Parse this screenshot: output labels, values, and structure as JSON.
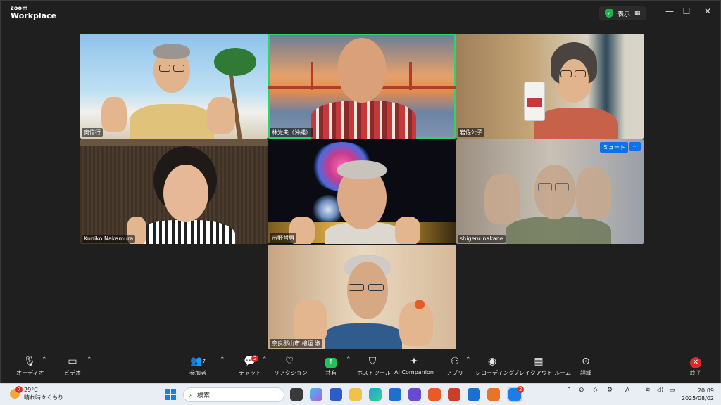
{
  "window": {
    "logo_line1": "zoom",
    "logo_line2": "Workplace",
    "view_label": "表示",
    "view_icon": "grid-icon",
    "controls": [
      "—",
      "☐",
      "✕"
    ]
  },
  "participants": [
    {
      "name": "奥信行",
      "bg": "#7fb7de"
    },
    {
      "name": "林光夫（沖縄）",
      "bg": "#d58a52",
      "active": true
    },
    {
      "name": "岩佐公子",
      "bg": "#b4956a"
    },
    {
      "name": "Kuniko Nakamura",
      "bg": "#4a3a2c"
    },
    {
      "name": "示野哲男",
      "bg": "#0b0b14"
    },
    {
      "name": "shigeru nakane",
      "bg": "#8c857a",
      "badges": [
        "ミュート",
        "···"
      ]
    },
    {
      "name": "奈良郡山市 檜垣 淑",
      "bg": "#caa989"
    }
  ],
  "toolbar": {
    "audio": {
      "label": "オーディオ",
      "icon": "microphone-icon"
    },
    "video": {
      "label": "ビデオ",
      "icon": "video-camera-icon"
    },
    "participants": {
      "label": "参加者",
      "count": "7",
      "icon": "participants-icon"
    },
    "chat": {
      "label": "チャット",
      "badge": "2",
      "icon": "chat-icon"
    },
    "reactions": {
      "label": "リアクション",
      "icon": "heart-icon"
    },
    "share": {
      "label": "共有",
      "icon": "share-arrow-icon"
    },
    "host_tools": {
      "label": "ホストツール",
      "icon": "shield-icon"
    },
    "ai": {
      "label": "AI Companion",
      "icon": "sparkle-icon"
    },
    "apps": {
      "label": "アプリ",
      "icon": "apps-icon"
    },
    "recording": {
      "label": "レコーディング",
      "icon": "record-icon"
    },
    "breakout": {
      "label": "ブレイクアウト ルーム",
      "icon": "breakout-grid-icon"
    },
    "more": {
      "label": "詳細",
      "icon": "more-dots-icon"
    },
    "end": {
      "label": "終了",
      "icon": "close-icon"
    }
  },
  "taskbar": {
    "weather_badge": "7",
    "temperature": "29°C",
    "weather_text": "晴れ時々くもり",
    "search_placeholder": "検索",
    "app_badge": "2",
    "time": "20:09",
    "date": "2025/08/02",
    "ime": "A"
  }
}
